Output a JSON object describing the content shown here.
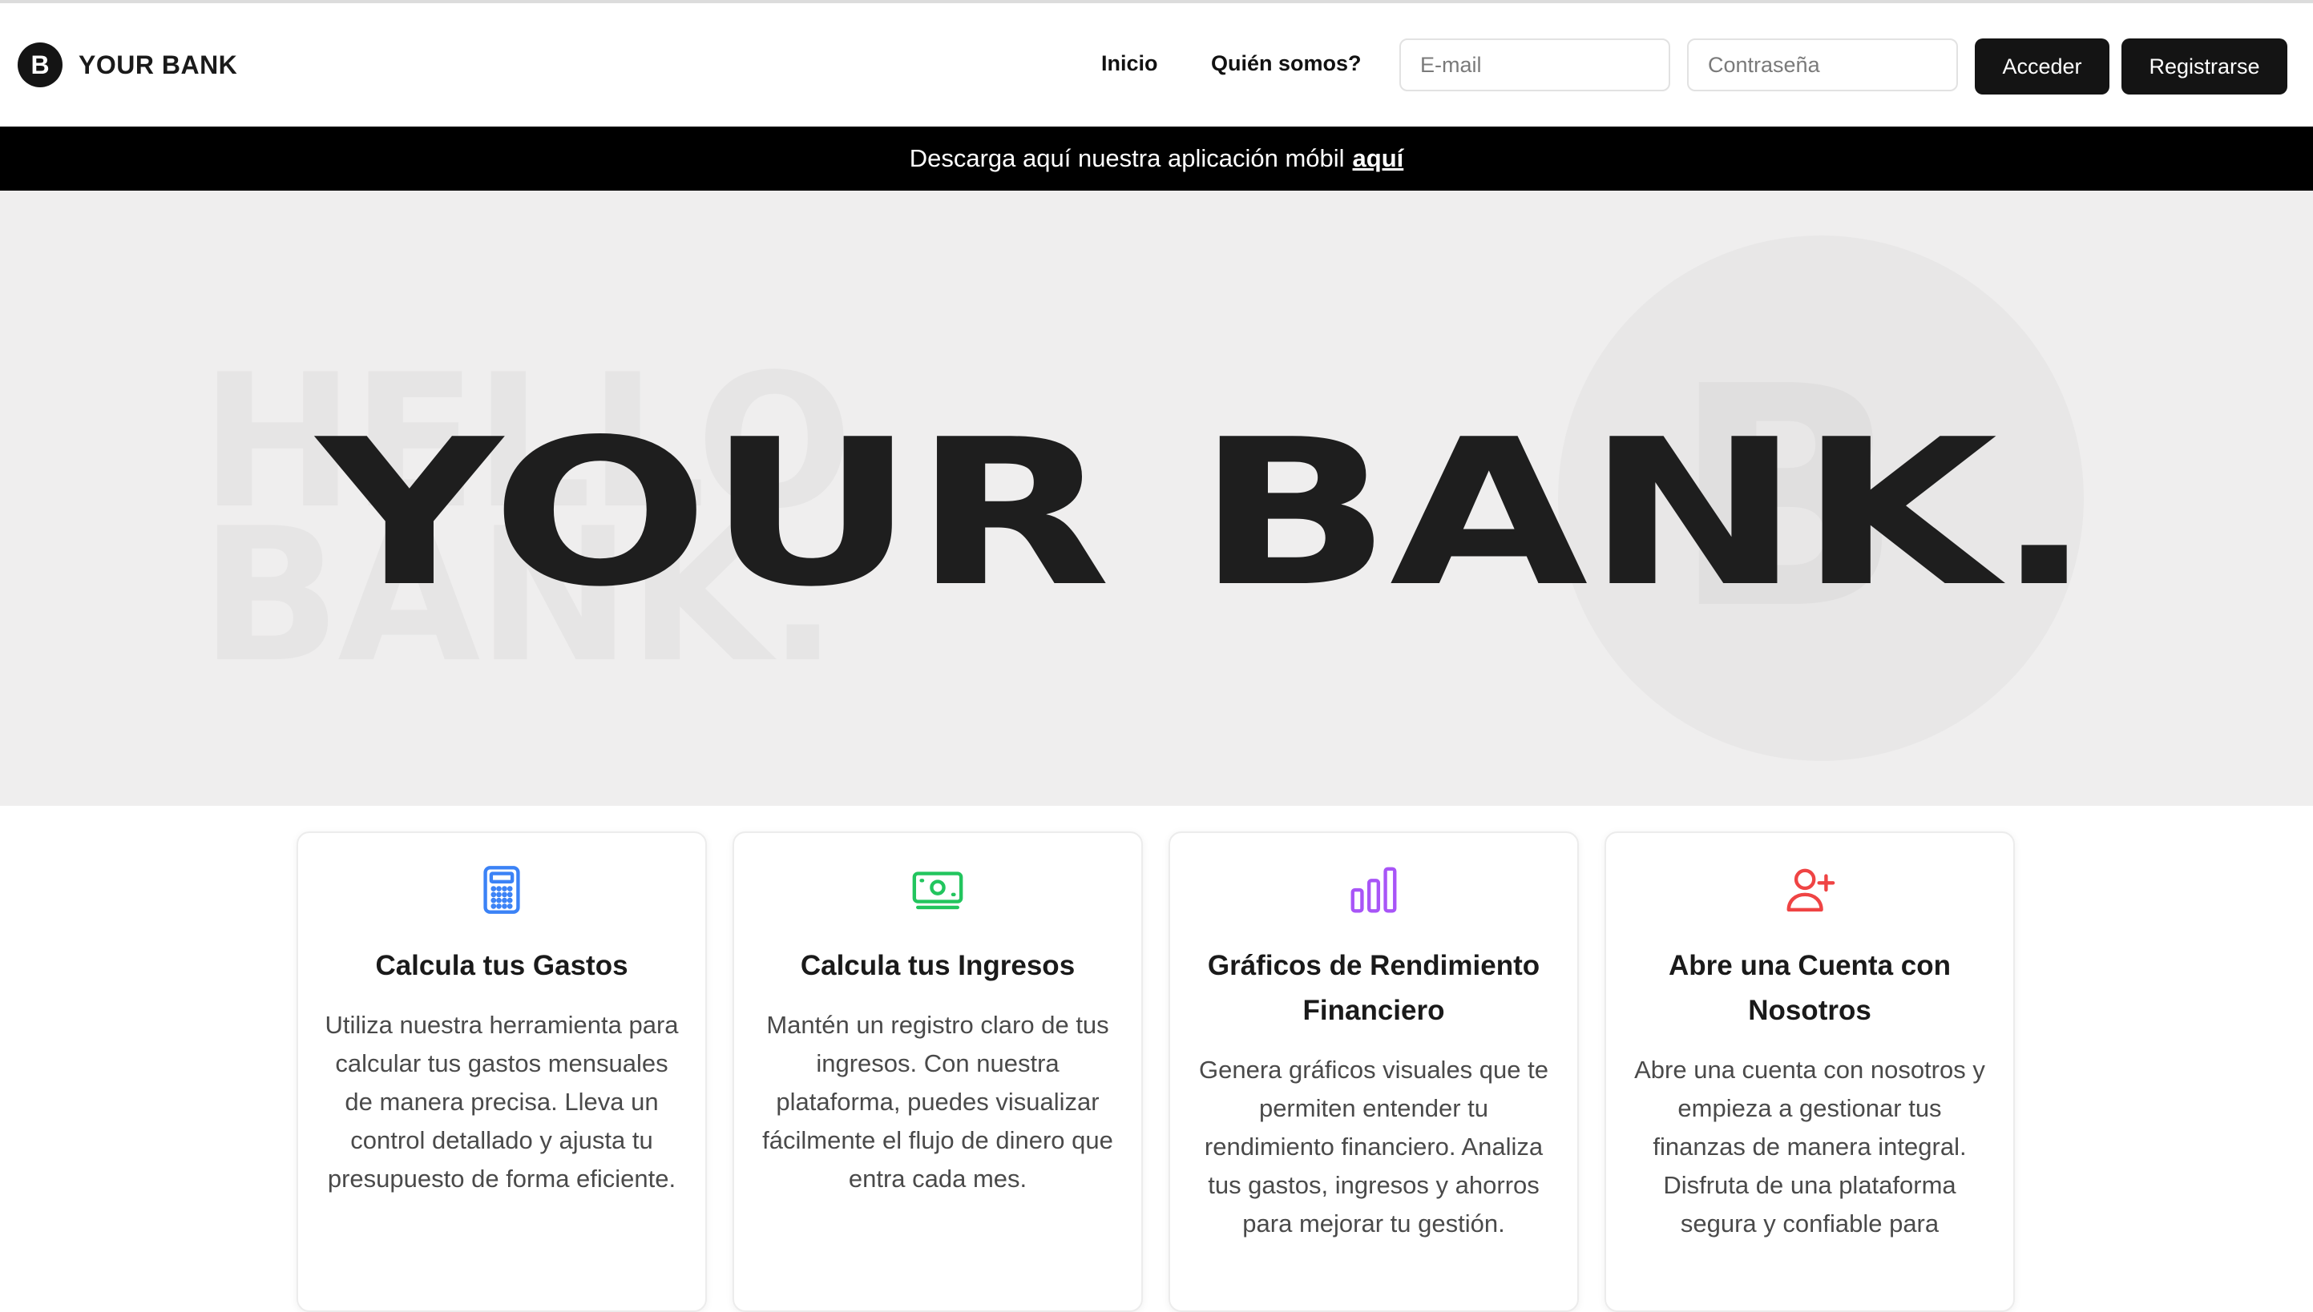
{
  "nav": {
    "brand_initial": "B",
    "brand_name": "YOUR BANK",
    "links": [
      "Inicio",
      "Quién somos?"
    ],
    "email_placeholder": "E-mail",
    "password_placeholder": "Contraseña",
    "login_label": "Acceder",
    "register_label": "Registrarse"
  },
  "banner": {
    "text": "Descarga aquí nuestra aplicación móbil",
    "link": "aquí"
  },
  "hero": {
    "title": "YOUR BANK.",
    "ghost_line1": "HELLO",
    "ghost_line2": "BANK.",
    "circle_letter": "B"
  },
  "cards": [
    {
      "icon": "calculator-icon",
      "color": "#3b82f6",
      "title": "Calcula tus Gastos",
      "text": "Utiliza nuestra herramienta para calcular tus gastos mensuales de manera precisa. Lleva un control detallado y ajusta tu presupuesto de forma eficiente."
    },
    {
      "icon": "cash-icon",
      "color": "#22c55e",
      "title": "Calcula tus Ingresos",
      "text": "Mantén un registro claro de tus ingresos. Con nuestra plataforma, puedes visualizar fácilmente el flujo de dinero que entra cada mes."
    },
    {
      "icon": "bar-chart-icon",
      "color": "#a855f7",
      "title": "Gráficos de Rendimiento Financiero",
      "text": "Genera gráficos visuales que te permiten entender tu rendimiento financiero. Analiza tus gastos, ingresos y ahorros para mejorar tu gestión."
    },
    {
      "icon": "user-plus-icon",
      "color": "#ef4444",
      "title": "Abre una Cuenta con Nosotros",
      "text": "Abre una cuenta con nosotros y empieza a gestionar tus finanzas de manera integral. Disfruta de una plataforma segura y confiable para"
    }
  ]
}
